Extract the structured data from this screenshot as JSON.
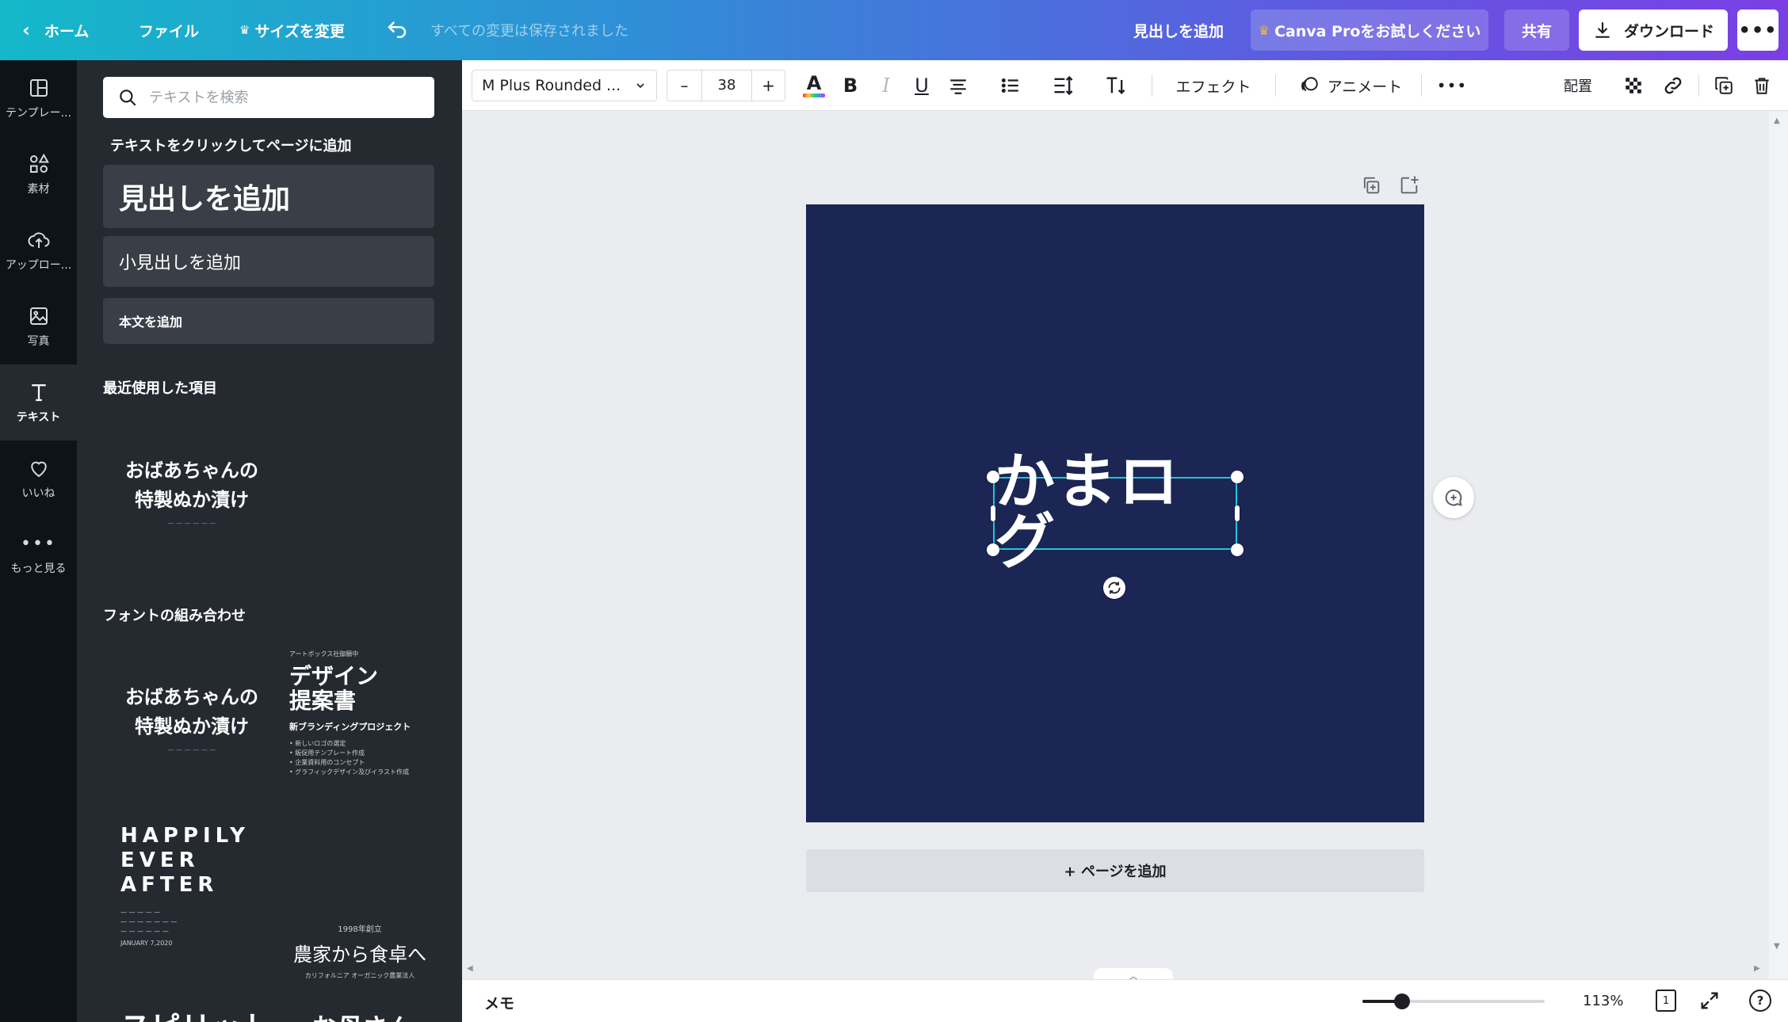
{
  "topbar": {
    "home_label": "ホーム",
    "file_label": "ファイル",
    "resize_label": "サイズを変更",
    "saved_status": "すべての変更は保存されました",
    "add_heading_label": "見出しを追加",
    "pro_label": "Canva Proをお試しください",
    "share_label": "共有",
    "download_label": "ダウンロード",
    "more_label": "•••"
  },
  "rail": {
    "items": [
      {
        "label": "テンプレー...",
        "icon": "template-icon"
      },
      {
        "label": "素材",
        "icon": "elements-icon"
      },
      {
        "label": "アップロー...",
        "icon": "upload-icon"
      },
      {
        "label": "写真",
        "icon": "photo-icon"
      },
      {
        "label": "テキスト",
        "icon": "text-icon"
      },
      {
        "label": "いいね",
        "icon": "heart-icon"
      },
      {
        "label": "もっと見る",
        "icon": "more-icon"
      }
    ]
  },
  "panel": {
    "search_placeholder": "テキストを検索",
    "click_hint": "テキストをクリックしてページに追加",
    "heading_btn": "見出しを追加",
    "subheading_btn": "小見出しを追加",
    "body_btn": "本文を追加",
    "recent_label": "最近使用した項目",
    "combos_label": "フォントの組み合わせ",
    "recent_combo": {
      "line1": "おばあちゃんの",
      "line2": "特製ぬか漬け"
    },
    "combo1": {
      "line1": "おばあちゃんの",
      "line2": "特製ぬか漬け"
    },
    "combo2": {
      "tag": "アートボックス社御願中",
      "line1": "デザイン",
      "line2": "提案書",
      "sub": "新ブランディングプロジェクト",
      "bullets": [
        "新しいロゴの選定",
        "販促用テンプレート作成",
        "企業資料用のコンセプト",
        "グラフィックデザイン及びイラスト作成"
      ]
    },
    "combo3": {
      "line1": "HAPPILY",
      "line2": "EVER",
      "line3": "AFTER",
      "date": "JANUARY 7,2020"
    },
    "combo4": {
      "year": "1998年創立",
      "main": "農家から食卓へ",
      "sub": "カリフォルニア オーガニック農業法人"
    },
    "combo5": {
      "text": "スピリット"
    },
    "combo6": {
      "text": "お母さん"
    }
  },
  "toolbar": {
    "font_name": "M Plus Rounded ...",
    "minus": "–",
    "font_size": "38",
    "plus": "+",
    "effects_label": "エフェクト",
    "animate_label": "アニメート",
    "more_label": "•••",
    "position_label": "配置"
  },
  "canvas": {
    "text": "かまログ",
    "add_page_label": "+ ページを追加",
    "page_color": "#1c2654",
    "selection_color": "#21c5d9"
  },
  "bottombar": {
    "notes_label": "メモ",
    "zoom_label": "113%",
    "page_count": "1",
    "help_label": "?"
  }
}
